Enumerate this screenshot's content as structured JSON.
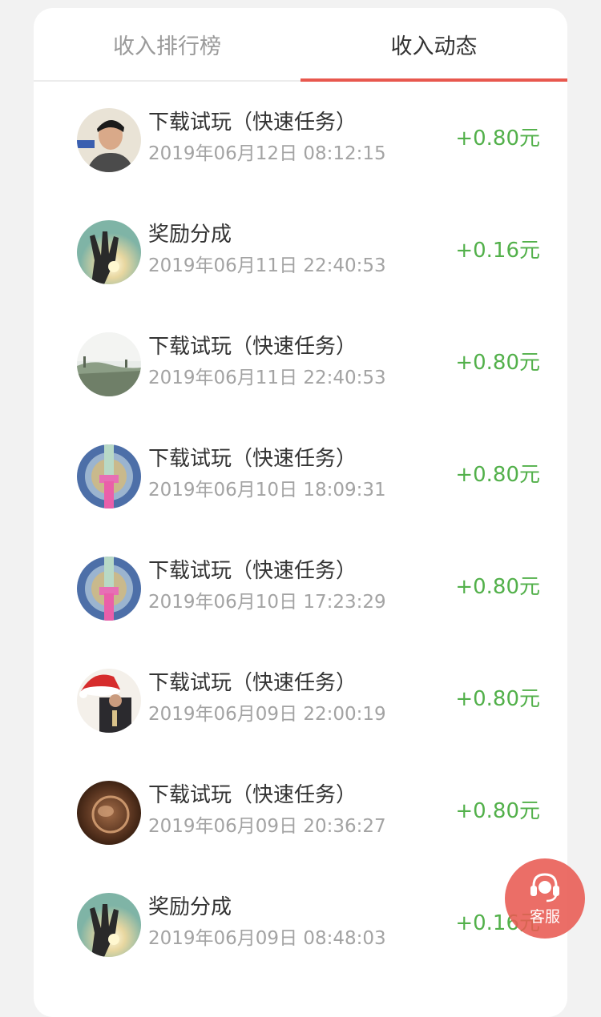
{
  "tabs": [
    {
      "label": "收入排行榜",
      "active": false
    },
    {
      "label": "收入动态",
      "active": true
    }
  ],
  "items": [
    {
      "title": "下载试玩（快速任务）",
      "time": "2019年06月12日 08:12:15",
      "amount": "+0.80元",
      "avatar": "person"
    },
    {
      "title": "奖励分成",
      "time": "2019年06月11日 22:40:53",
      "amount": "+0.16元",
      "avatar": "hand-light"
    },
    {
      "title": "下载试玩（快速任务）",
      "time": "2019年06月11日 22:40:53",
      "amount": "+0.80元",
      "avatar": "landscape"
    },
    {
      "title": "下载试玩（快速任务）",
      "time": "2019年06月10日 18:09:31",
      "amount": "+0.80元",
      "avatar": "pink-object"
    },
    {
      "title": "下载试玩（快速任务）",
      "time": "2019年06月10日 17:23:29",
      "amount": "+0.80元",
      "avatar": "pink-object"
    },
    {
      "title": "下载试玩（快速任务）",
      "time": "2019年06月09日 22:00:19",
      "amount": "+0.80元",
      "avatar": "santa-hat"
    },
    {
      "title": "下载试玩（快速任务）",
      "time": "2019年06月09日 20:36:27",
      "amount": "+0.80元",
      "avatar": "sepia"
    },
    {
      "title": "奖励分成",
      "time": "2019年06月09日 08:48:03",
      "amount": "+0.16元",
      "avatar": "hand-light"
    }
  ],
  "customer_service": {
    "label": "客服",
    "icon": "headset-icon"
  },
  "colors": {
    "accent": "#e8584e",
    "amount": "#52b04a",
    "service_bg": "#e85a52"
  }
}
